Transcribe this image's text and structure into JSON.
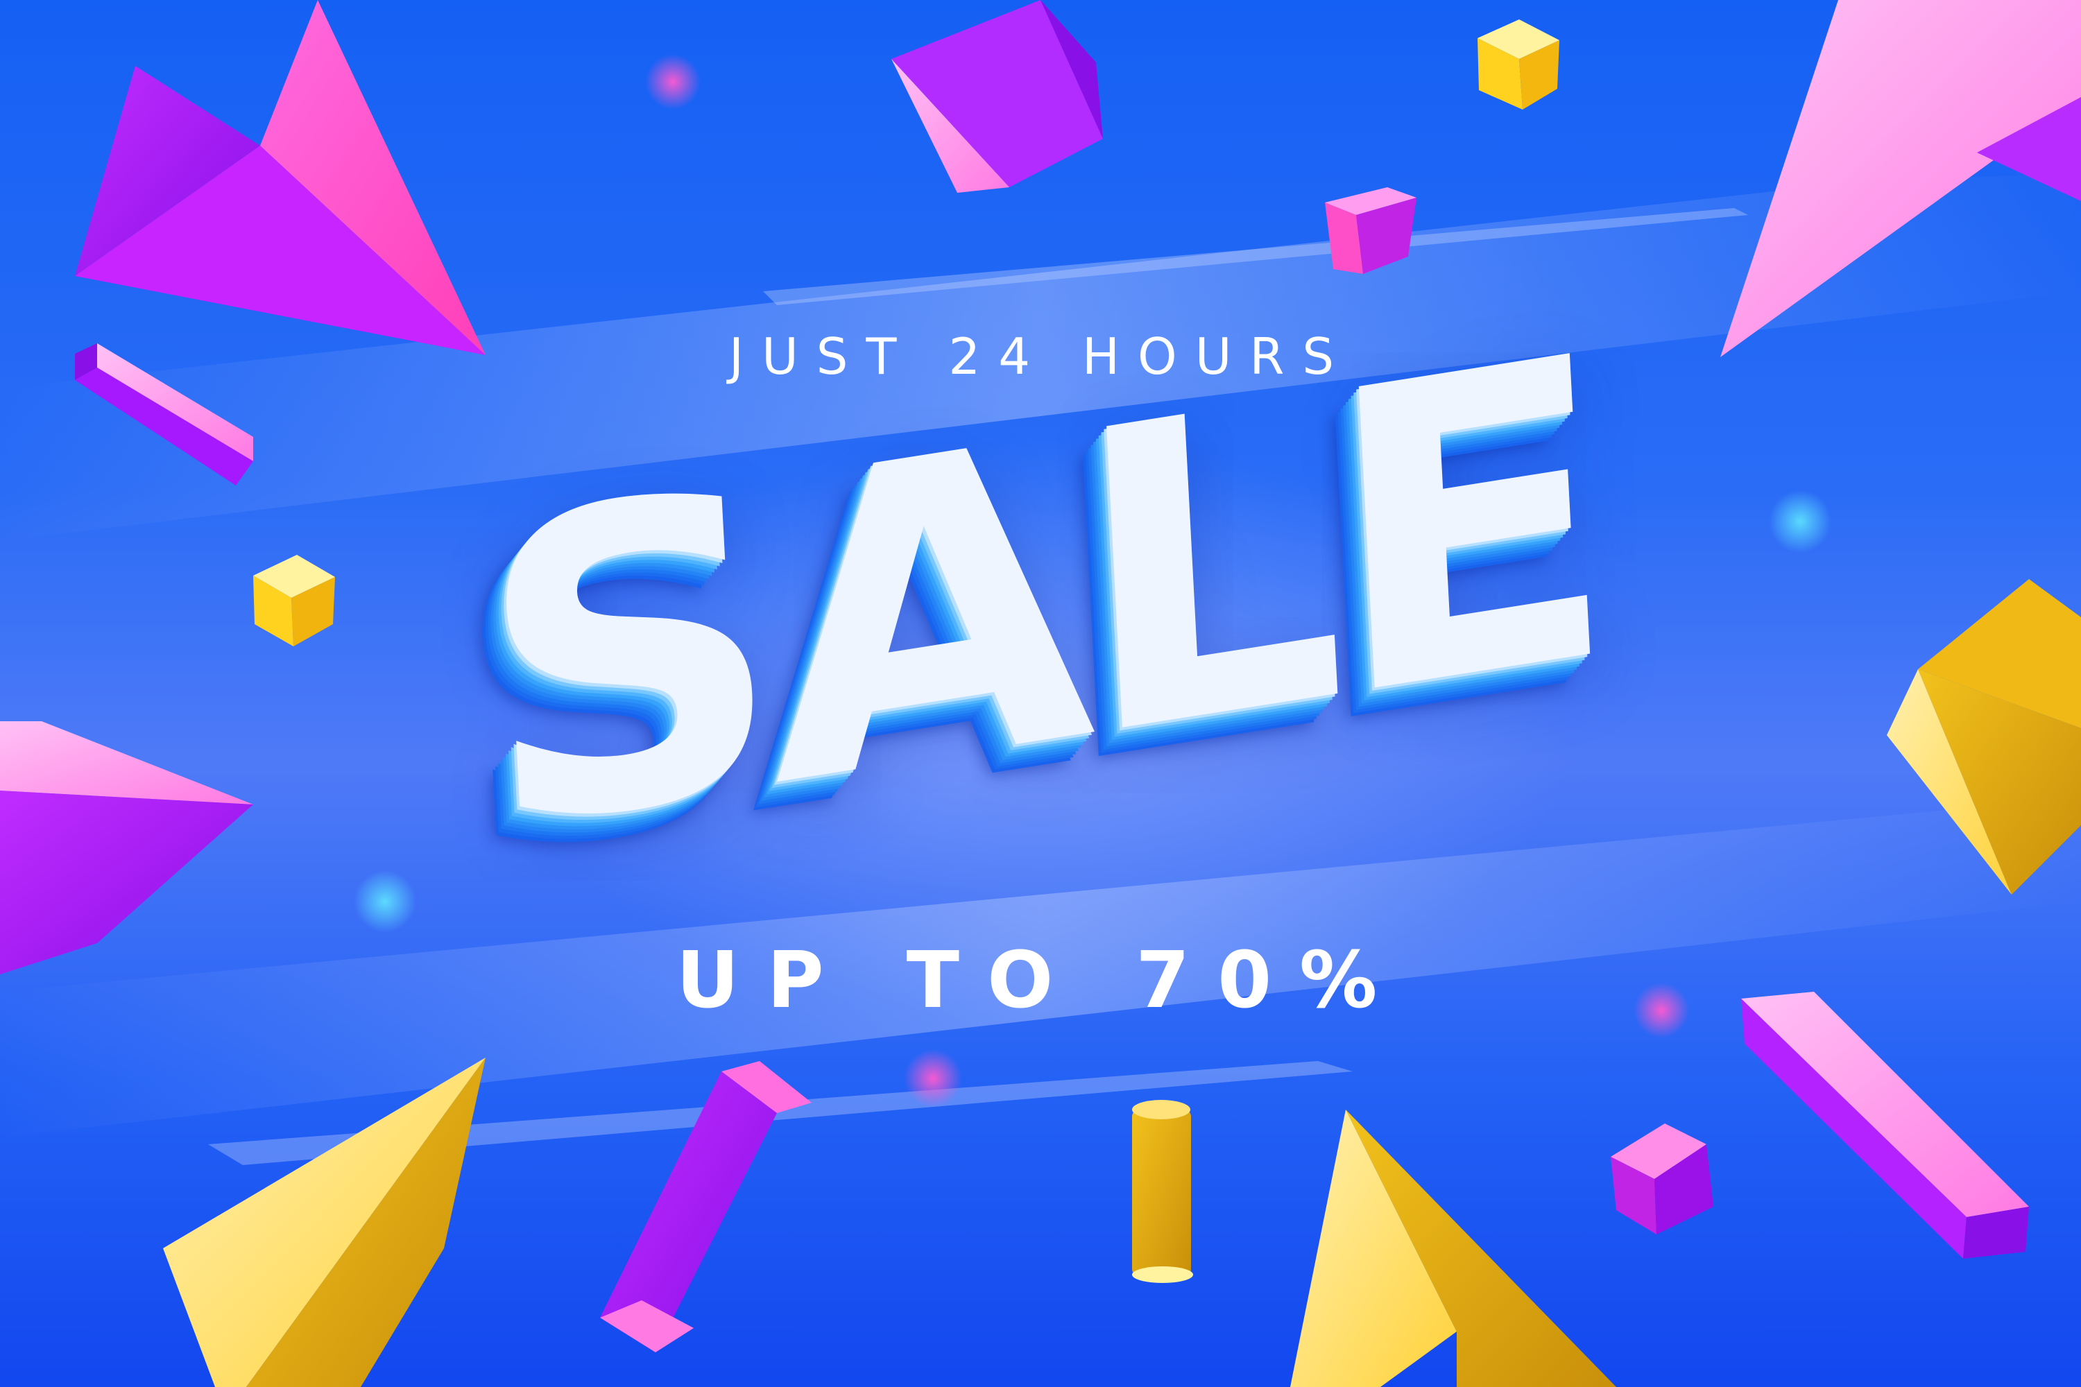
{
  "banner": {
    "top_line": "JUST 24 HOURS",
    "headline": "SALE",
    "offer_line": "UP TO 70%"
  },
  "colors": {
    "background_primary": "#1a55f5",
    "background_glow": "#96afff",
    "accent_purple": "#b300ff",
    "accent_pink": "#ff4fd8",
    "accent_yellow": "#ffd21f",
    "accent_gold": "#d9a90f",
    "headline_face": "#eef5ff",
    "headline_extrude": "#2585f6",
    "text_white": "#ffffff"
  },
  "decorations": {
    "shapes": [
      "pyramid",
      "cube",
      "bar",
      "cylinder",
      "orb"
    ]
  }
}
